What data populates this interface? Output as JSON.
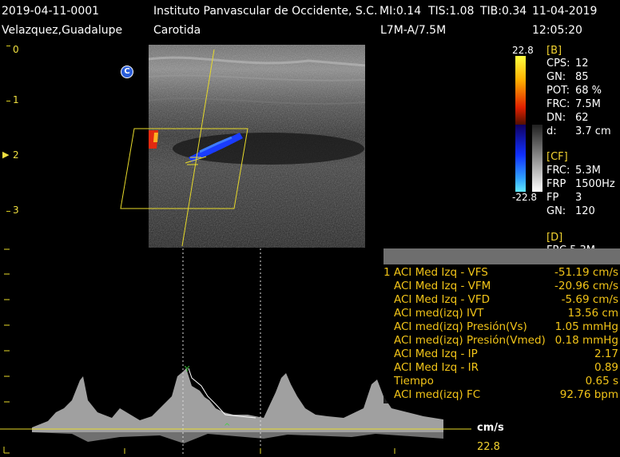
{
  "header": {
    "patient_id": "2019-04-11-0001",
    "institution": "Instituto Panvascular de Occidente, S.C.",
    "mi": "MI:0.14",
    "tis": "TIS:1.08",
    "tib": "TIB:0.34",
    "date": "11-04-2019",
    "patient_name": "Velazquez,Guadalupe",
    "exam": "Carotida",
    "probe": "L7M-A/7.5M",
    "time": "12:05:20"
  },
  "image": {
    "marker": "C",
    "depth_labels": [
      "0",
      "1",
      "2",
      "3"
    ]
  },
  "colorbar": {
    "top": "22.8",
    "bottom": "-22.8"
  },
  "params": {
    "b_header": "[B]",
    "b": [
      {
        "k": "CPS:",
        "v": "12"
      },
      {
        "k": "GN:",
        "v": "85"
      },
      {
        "k": "POT:",
        "v": "68 %"
      },
      {
        "k": "FRC:",
        "v": "7.5M"
      },
      {
        "k": "DN:",
        "v": "62"
      },
      {
        "k": "d:",
        "v": "3.7 cm"
      }
    ],
    "cf_header": "[CF]",
    "cf": [
      {
        "k": "FRC:",
        "v": "5.3M"
      },
      {
        "k": "FRP",
        "v": "1500Hz"
      },
      {
        "k": "FP",
        "v": "3"
      },
      {
        "k": "GN:",
        "v": "120"
      }
    ],
    "d_header": "[D]",
    "d_partial": "FRC 5.3M"
  },
  "measurements": [
    {
      "label": "1 ACI Med Izq - VFS",
      "value": "-51.19 cm/s"
    },
    {
      "label": "ACI Med Izq - VFM",
      "value": "-20.96 cm/s"
    },
    {
      "label": "ACI Med Izq - VFD",
      "value": "-5.69 cm/s"
    },
    {
      "label": "ACI med(izq) IVT",
      "value": "13.56 cm"
    },
    {
      "label": "ACI med(izq) Presión(Vs)",
      "value": "1.05 mmHg"
    },
    {
      "label": "ACI med(izq) Presión(Vmed)",
      "value": "0.18 mmHg"
    },
    {
      "label": "ACI Med Izq - IP",
      "value": "2.17"
    },
    {
      "label": "ACI Med Izq - IR",
      "value": "0.89"
    },
    {
      "label": "Tiempo",
      "value": "0.65 s"
    },
    {
      "label": "ACI med(izq) FC",
      "value": "92.76 bpm"
    }
  ],
  "spectral": {
    "unit": "cm/s",
    "scale_bottom": "22.8"
  },
  "colors": {
    "accent_yellow": "#f2d230",
    "panel_header": "#6e6e6e",
    "measurement_text": "#f2c418"
  }
}
